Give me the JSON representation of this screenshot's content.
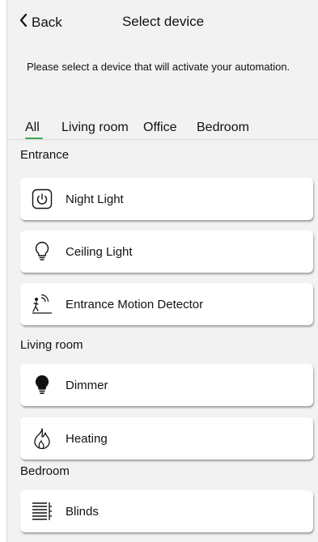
{
  "header": {
    "back_label": "Back",
    "title": "Select device"
  },
  "description": "Please select a device that will activate your automation.",
  "tabs": [
    {
      "label": "All"
    },
    {
      "label": "Living room"
    },
    {
      "label": "Office"
    },
    {
      "label": "Bedroom"
    }
  ],
  "sections": {
    "entrance": {
      "label": "Entrance",
      "devices": [
        {
          "label": "Night Light",
          "icon": "power-icon"
        },
        {
          "label": "Ceiling Light",
          "icon": "lightbulb-outline-icon"
        },
        {
          "label": "Entrance Motion Detector",
          "icon": "motion-detector-icon"
        }
      ]
    },
    "living_room": {
      "label": "Living room",
      "devices": [
        {
          "label": "Dimmer",
          "icon": "lightbulb-filled-icon"
        },
        {
          "label": "Heating",
          "icon": "flame-icon"
        }
      ]
    },
    "bedroom": {
      "label": "Bedroom",
      "devices": [
        {
          "label": "Blinds",
          "icon": "blinds-icon"
        }
      ]
    }
  },
  "colors": {
    "active_tab_underline": "#3aa655",
    "background": "#f2f2f2",
    "card": "#ffffff"
  }
}
